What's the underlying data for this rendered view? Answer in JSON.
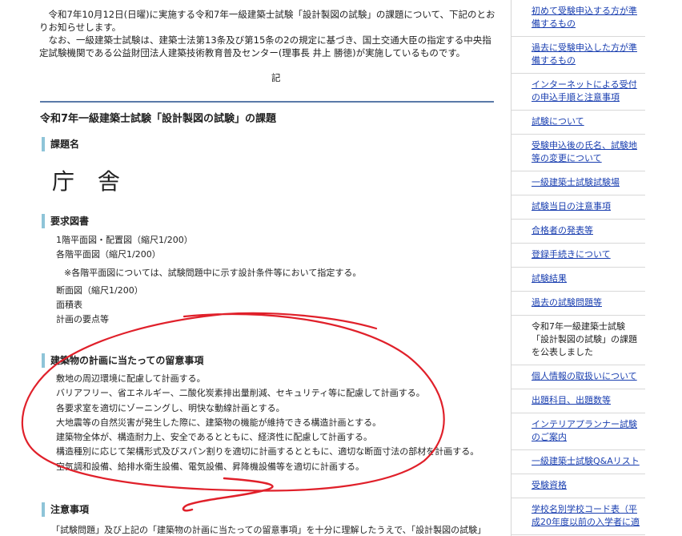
{
  "intro": {
    "p1": "令和7年10月12日(日曜)に実施する令和7年一級建築士試験「設計製図の試験」の課題について、下記のとおりお知らせします。",
    "p2": "なお、一級建築士試験は、建築士法第13条及び第15条の2の規定に基づき、国土交通大臣の指定する中央指定試験機関である公益財団法人建築技術教育普及センター(理事長 井上 勝徳)が実施しているものです。",
    "ki": "記"
  },
  "section_title": "令和7年一級建築士試験「設計製図の試験」の課題",
  "subject": {
    "heading": "課題名",
    "name": "庁 舎"
  },
  "drawings": {
    "heading": "要求図書",
    "items": [
      "1階平面図・配置図（縮尺1/200）",
      "各階平面図（縮尺1/200）"
    ],
    "note": "※各階平面図については、試験問題中に示す設計条件等において指定する。",
    "items2": [
      "断面図（縮尺1/200）",
      "面積表",
      "計画の要点等"
    ]
  },
  "points": {
    "heading": "建築物の計画に当たっての留意事項",
    "items": [
      "敷地の周辺環境に配慮して計画する。",
      "バリアフリー、省エネルギー、二酸化炭素排出量削減、セキュリティ等に配慮して計画する。",
      "各要求室を適切にゾーニングし、明快な動線計画とする。",
      "大地震等の自然災害が発生した際に、建築物の機能が維持できる構造計画とする。",
      "建築物全体が、構造耐力上、安全であるとともに、経済性に配慮して計画する。",
      "構造種別に応じて架構形式及びスパン割りを適切に計画するとともに、適切な断面寸法の部材を計画する。",
      "空気調和設備、給排水衛生設備、電気設備、昇降機設備等を適切に計画する。"
    ]
  },
  "notice": {
    "heading": "注意事項",
    "text": "「試験問題」及び上記の「建築物の計画に当たっての留意事項」を十分に理解したうえで、「設計製図の試験」"
  },
  "sidebar": {
    "items": [
      {
        "label": "初めて受験申込する方が準備するもの",
        "link": true
      },
      {
        "label": "過去に受験申込した方が準備するもの",
        "link": true
      },
      {
        "label": "インターネットによる受付の申込手順と注意事項",
        "link": true
      },
      {
        "label": "試験について",
        "link": true
      },
      {
        "label": "受験申込後の氏名、試験地等の変更について",
        "link": true
      },
      {
        "label": "一級建築士試験試験場",
        "link": true
      },
      {
        "label": "試験当日の注意事項",
        "link": true
      },
      {
        "label": "合格者の発表等",
        "link": true
      },
      {
        "label": "登録手続きについて",
        "link": true
      },
      {
        "label": "試験結果",
        "link": true
      },
      {
        "label": "過去の試験問題等",
        "link": true
      },
      {
        "label": "令和7年一級建築士試験「設計製図の試験」の課題を公表しました",
        "link": false
      },
      {
        "label": "個人情報の取扱いについて",
        "link": true
      },
      {
        "label": "出題科目、出題数等",
        "link": true
      },
      {
        "label": "インテリアプランナー試験のご案内",
        "link": true
      },
      {
        "label": "一級建築士試験Q&Aリスト",
        "link": true
      },
      {
        "label": "受験資格",
        "link": true
      },
      {
        "label": "学校名別学校コード表（平成20年度以前の入学者に適",
        "link": true
      }
    ]
  },
  "colors": {
    "link": "#1a3fb0",
    "accent_bar": "#8ec4d8",
    "rule": "#5a7aa8",
    "annotation": "#e0202a"
  }
}
